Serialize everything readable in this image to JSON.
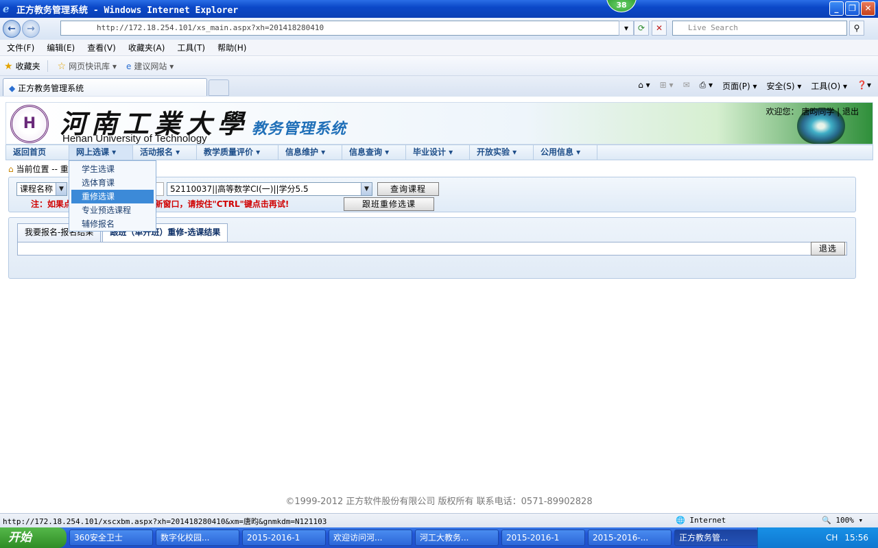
{
  "window": {
    "title": "正方教务管理系统 - Windows Internet Explorer",
    "badge": "38"
  },
  "browser": {
    "address": "http://172.18.254.101/xs_main.aspx?xh=201418280410",
    "search_placeholder": "Live Search",
    "menu": [
      "文件(F)",
      "编辑(E)",
      "查看(V)",
      "收藏夹(A)",
      "工具(T)",
      "帮助(H)"
    ],
    "favorites": {
      "label": "收藏夹",
      "items": [
        "网页快讯库 ▾",
        "建议网站 ▾"
      ]
    },
    "tab_title": "正方教务管理系统",
    "commands": [
      "页面(P) ▾",
      "安全(S) ▾",
      "工具(O) ▾"
    ],
    "status_url": "http://172.18.254.101/xscxbm.aspx?xh=201418280410&xm=唐昀&gnmkdm=N121103",
    "zone": "Internet",
    "zoom": "100%"
  },
  "site": {
    "univ_cn": "河南工業大學",
    "univ_en": "Henan University of Technology",
    "system_name": "教务管理系统",
    "welcome": "欢迎您：  唐昀同学 | 退出",
    "nav": [
      "返回首页",
      "网上选课 ▾",
      "活动报名 ▾",
      "教学质量评价 ▾",
      "信息维护 ▾",
      "信息查询 ▾",
      "毕业设计 ▾",
      "开放实验 ▾",
      "公用信息 ▾"
    ],
    "dropdown": [
      "学生选课",
      "选体育课",
      "重修选课",
      "专业预选课程",
      "辅修报名"
    ],
    "breadcrumb": "当前位置 -- 重",
    "search": {
      "field_select": "课程名称",
      "course_select": "52110037||高等数学CⅠ(一)||学分5.5",
      "query_button": "查询课程",
      "notice": "注：如果点击\"选课\"按钮不能弹出新窗口，请按住\"CTRL\"键点击再试!",
      "retake_button": "跟班重修选课"
    },
    "tabs": [
      "我要报名-报名结果",
      "跟班（单开班）重修-选课结果"
    ],
    "withdraw_button": "退选",
    "footer": "©1999-2012  正方软件股份有限公司  版权所有  联系电话：0571-89902828"
  },
  "taskbar": {
    "start": "开始",
    "tasks": [
      "360安全卫士",
      "数字化校园...",
      "2015-2016-1",
      "欢迎访问河...",
      "河工大教务...",
      "2015-2016-1",
      "2015-2016-...",
      "正方教务管..."
    ],
    "lang": "CH",
    "clock": "15:56"
  }
}
